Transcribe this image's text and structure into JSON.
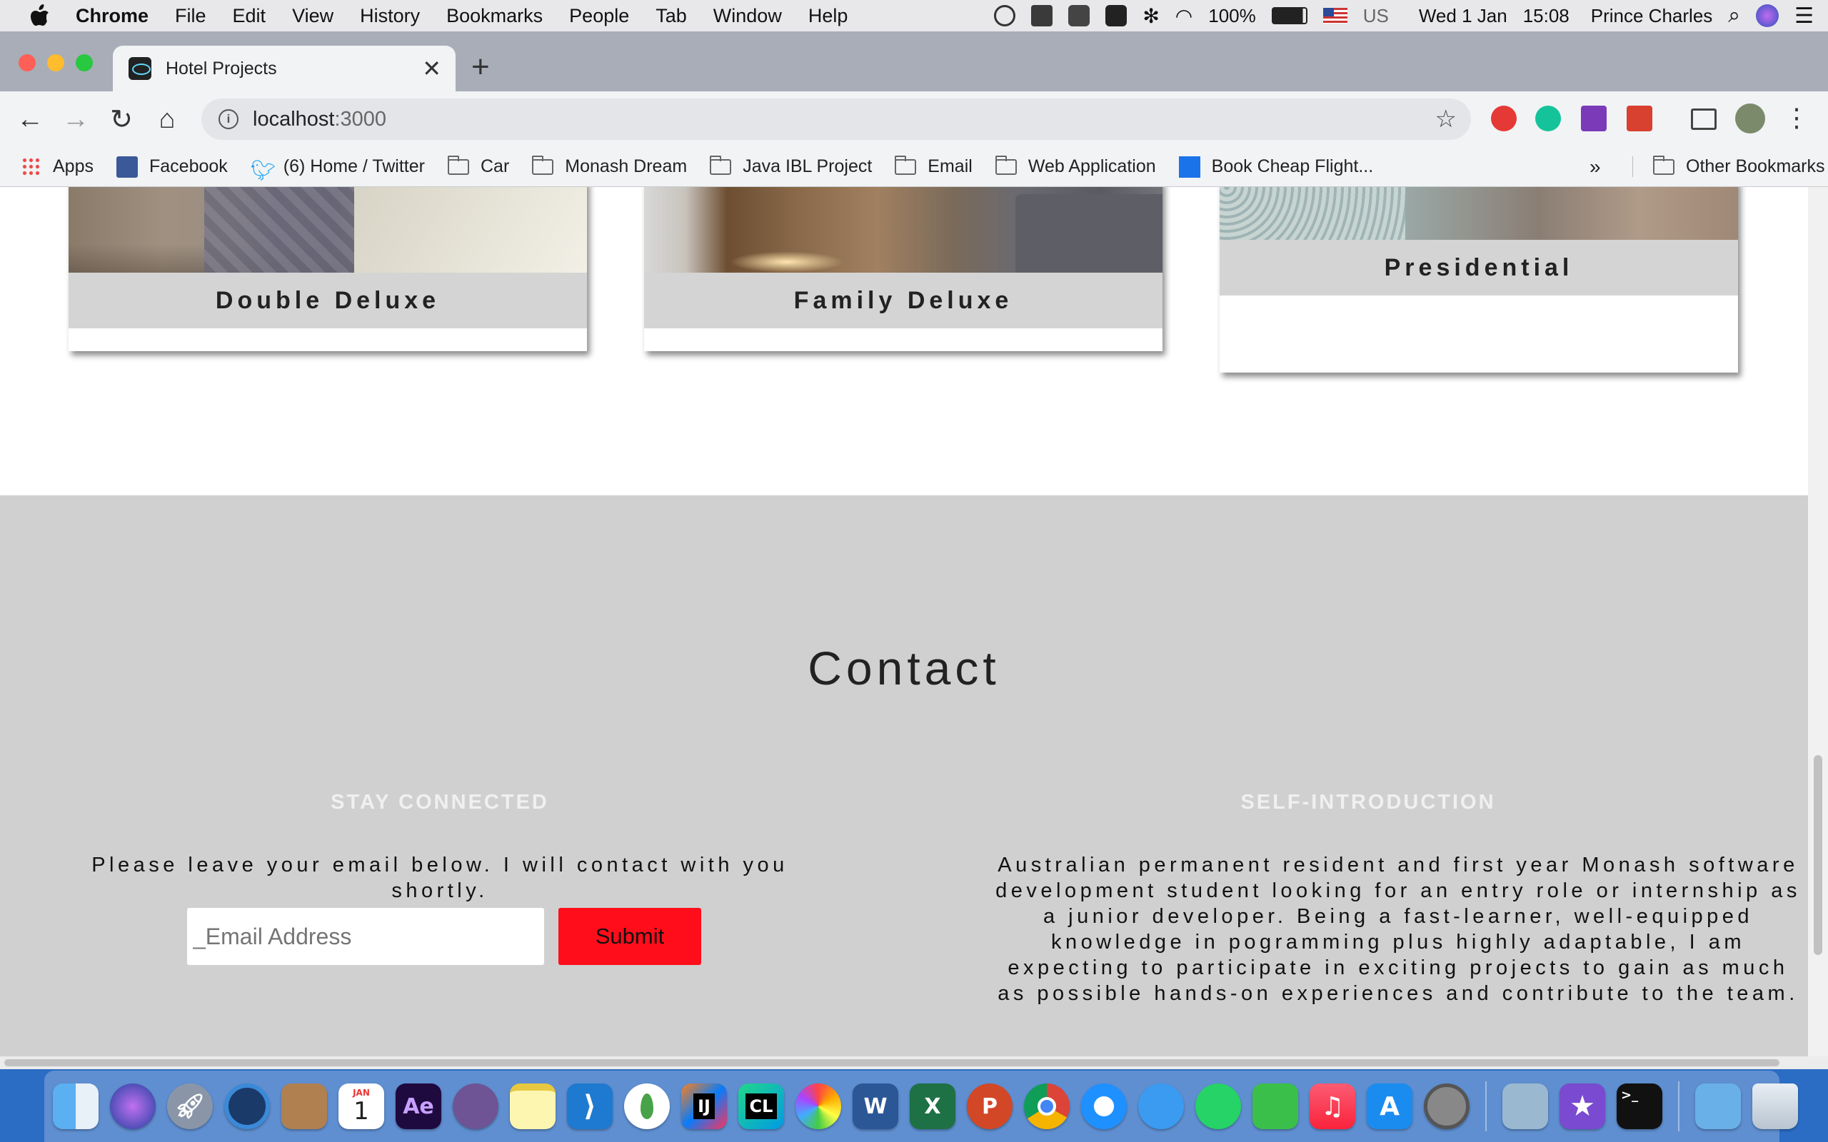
{
  "menubar": {
    "app": "Chrome",
    "items": [
      "File",
      "Edit",
      "View",
      "History",
      "Bookmarks",
      "People",
      "Tab",
      "Window",
      "Help"
    ],
    "battery": "100%",
    "input_source": "US",
    "date": "Wed 1 Jan",
    "time": "15:08",
    "user": "Prince Charles"
  },
  "tab": {
    "title": "Hotel Projects"
  },
  "toolbar": {
    "url_host": "localhost",
    "url_port": ":3000"
  },
  "bookmarks": {
    "items": [
      "Apps",
      "Facebook",
      "(6) Home / Twitter",
      "Car",
      "Monash Dream",
      "Java IBL Project",
      "Email",
      "Web Application",
      "Book Cheap Flight..."
    ],
    "overflow": "»",
    "other": "Other Bookmarks"
  },
  "rooms": [
    {
      "name": "Double Deluxe"
    },
    {
      "name": "Family Deluxe"
    },
    {
      "name": "Presidential"
    }
  ],
  "contact": {
    "title": "Contact",
    "left_heading": "STAY CONNECTED",
    "left_text": "Please leave your email below. I will contact with you shortly.",
    "email_placeholder": "_Email Address",
    "submit_label": "Submit",
    "right_heading": "SELF-INTRODUCTION",
    "right_text": "Australian permanent resident and first year Monash software development student looking for an entry role or internship as a junior developer. Being a fast-learner, well-equipped knowledge in pogramming plus highly adaptable, I am expecting to participate in exciting projects to gain as much as possible hands-on experiences and contribute to the team."
  },
  "dock": {
    "calendar_month": "JAN",
    "calendar_day": "1",
    "after_effects": "Ae",
    "intellij": "IJ",
    "clion": "CL",
    "word": "W",
    "excel": "X",
    "powerpoint": "P"
  },
  "colors": {
    "submit": "#ff0d1a",
    "contact_bg": "#d0d0d0",
    "caption_bg": "#d4d4d4"
  }
}
